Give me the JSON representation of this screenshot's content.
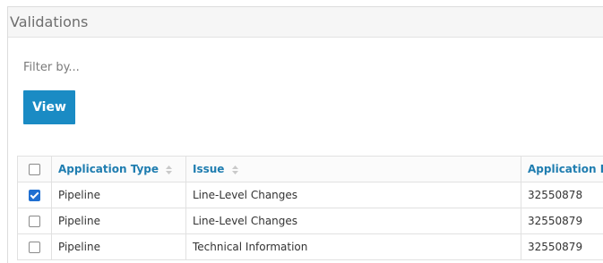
{
  "panel": {
    "title": "Validations"
  },
  "filter": {
    "label": "Filter by..."
  },
  "actions": {
    "view_label": "View"
  },
  "table": {
    "columns": [
      "Application Type",
      "Issue",
      "Application ID"
    ],
    "rows": [
      {
        "checked": true,
        "type": "Pipeline",
        "issue": "Line-Level Changes",
        "id": "32550878"
      },
      {
        "checked": false,
        "type": "Pipeline",
        "issue": "Line-Level Changes",
        "id": "32550879"
      },
      {
        "checked": false,
        "type": "Pipeline",
        "issue": "Technical Information",
        "id": "32550879"
      }
    ]
  },
  "colors": {
    "accent": "#1a8bc4",
    "header_text": "#1f7db0",
    "checkbox_checked": "#1f6fd1"
  }
}
